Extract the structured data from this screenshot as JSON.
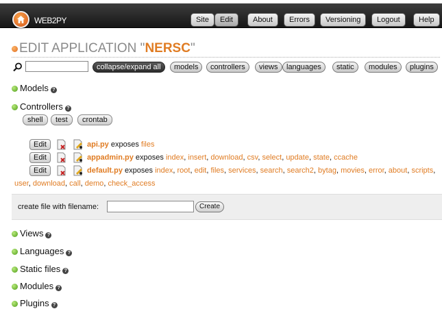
{
  "header": {
    "brand": "WEB2PY",
    "nav": [
      {
        "label": "Site"
      },
      {
        "label": "Edit",
        "active": true
      },
      {
        "label": "About"
      },
      {
        "label": "Errors"
      },
      {
        "label": "Versioning"
      },
      {
        "label": "Logout"
      },
      {
        "label": "Help"
      }
    ]
  },
  "title": {
    "prefix": "EDIT APPLICATION \"",
    "app": "NERSC",
    "suffix": "\""
  },
  "search": {
    "value": "",
    "placeholder": ""
  },
  "filters": {
    "collapse_label": "collapse/expand all",
    "items": [
      "models",
      "controllers",
      "views",
      "languages",
      "static",
      "modules",
      "plugins"
    ]
  },
  "sections": {
    "models": "Models",
    "controllers": "Controllers",
    "views": "Views",
    "languages": "Languages",
    "static": "Static files",
    "modules": "Modules",
    "plugins": "Plugins"
  },
  "help_glyph": "?",
  "controller_actions": [
    "shell",
    "test",
    "crontab"
  ],
  "edit_label": "Edit",
  "exposes_label": "exposes",
  "controllers": [
    {
      "file": "api.py",
      "functions": [
        "files"
      ]
    },
    {
      "file": "appadmin.py",
      "functions": [
        "index",
        "insert",
        "download",
        "csv",
        "select",
        "update",
        "state",
        "ccache"
      ]
    },
    {
      "file": "default.py",
      "functions": [
        "index",
        "root",
        "edit",
        "files",
        "services",
        "search",
        "search2",
        "bytag",
        "movies",
        "error",
        "about",
        "scripts"
      ],
      "functions_cont": [
        "user",
        "download",
        "call",
        "demo",
        "check_access"
      ]
    }
  ],
  "create": {
    "label": "create file with filename:",
    "value": "",
    "button": "Create"
  },
  "colors": {
    "accent": "#e07c23",
    "topbar": "#1f1f1f",
    "status_green": "#4d9c17"
  }
}
